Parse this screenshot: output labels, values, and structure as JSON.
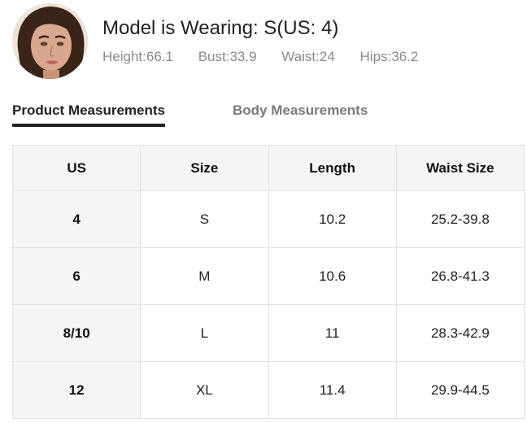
{
  "model": {
    "title": "Model is Wearing: S(US: 4)",
    "stats": [
      {
        "label": "Height:",
        "value": "66.1"
      },
      {
        "label": "Bust:",
        "value": "33.9"
      },
      {
        "label": "Waist:",
        "value": "24"
      },
      {
        "label": "Hips:",
        "value": "36.2"
      }
    ]
  },
  "tabs": [
    {
      "label": "Product Measurements",
      "active": true
    },
    {
      "label": "Body Measurements",
      "active": false
    }
  ],
  "table": {
    "headers": [
      "US",
      "Size",
      "Length",
      "Waist Size"
    ],
    "rows": [
      [
        "4",
        "S",
        "10.2",
        "25.2-39.8"
      ],
      [
        "6",
        "M",
        "10.6",
        "26.8-41.3"
      ],
      [
        "8/10",
        "L",
        "11",
        "28.3-42.9"
      ],
      [
        "12",
        "XL",
        "11.4",
        "29.9-44.5"
      ]
    ]
  },
  "colors": {
    "text": "#222222",
    "muted": "#8a8a8a",
    "header_bg": "#f5f5f5",
    "border": "#e2e2e2"
  }
}
